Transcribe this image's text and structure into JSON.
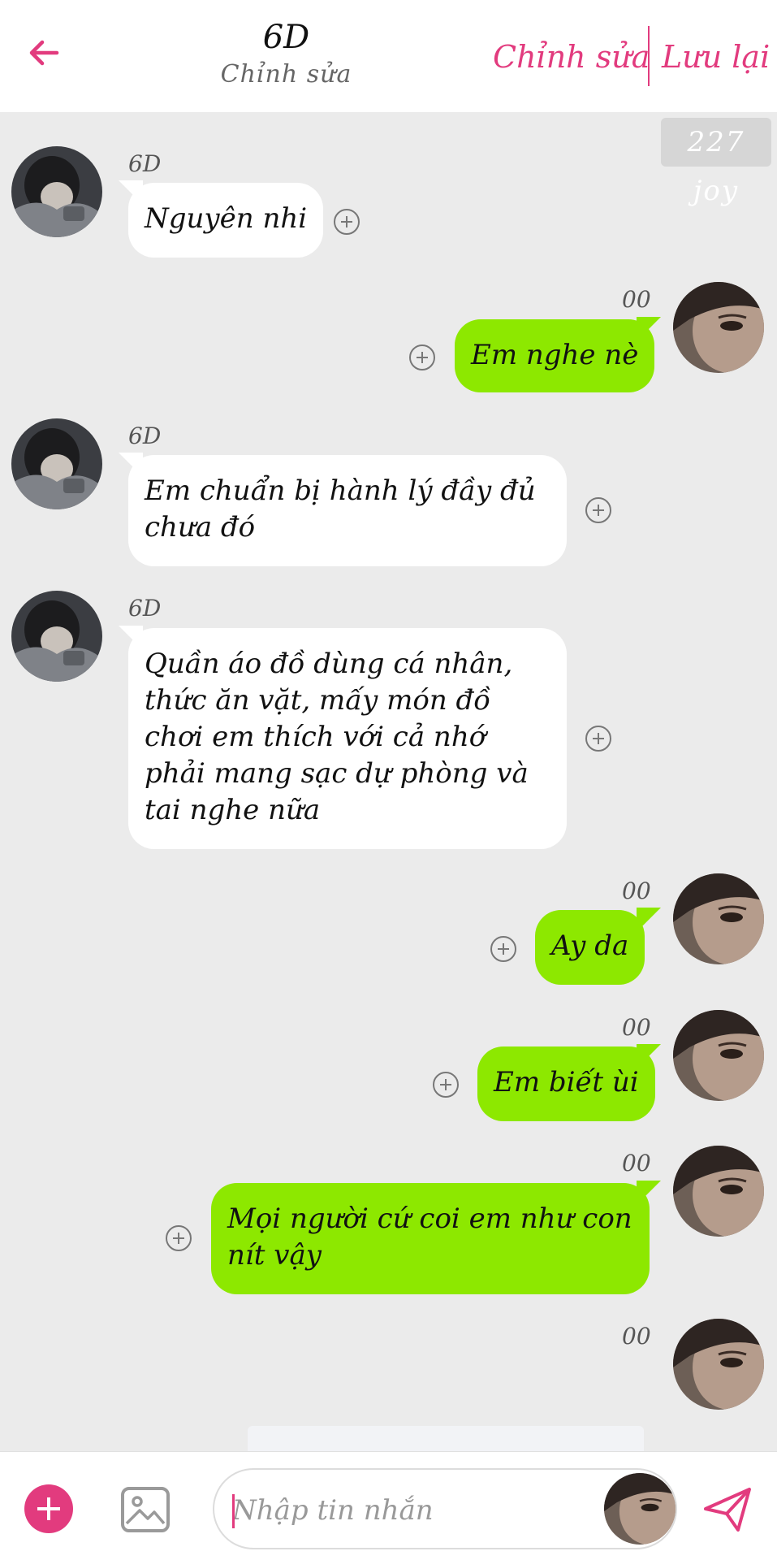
{
  "header": {
    "title": "6D",
    "subtitle": "Chỉnh sửa",
    "edit_label": "Chỉnh sửa",
    "save_label": "Lưu lại",
    "accent_color": "#e23b7e"
  },
  "watermark": "227 joy",
  "messages": [
    {
      "side": "left",
      "sender": "6D",
      "text": "Nguyên nhi"
    },
    {
      "side": "right",
      "sender": "00",
      "text": "Em nghe nè"
    },
    {
      "side": "left",
      "sender": "6D",
      "lines": [
        "Em chuẩn bị hành lý đầy đủ",
        "chưa đó"
      ]
    },
    {
      "side": "left",
      "sender": "6D",
      "lines": [
        "Quần áo đồ dùng cá nhân,",
        "thức ăn vặt, mấy món đồ",
        "chơi em thích với cả nhớ",
        "phải mang sạc dự phòng và",
        "tai nghe nữa"
      ]
    },
    {
      "side": "right",
      "sender": "00",
      "text": "Ay da"
    },
    {
      "side": "right",
      "sender": "00",
      "text": "Em biết ùi"
    },
    {
      "side": "right",
      "sender": "00",
      "lines": [
        "Mọi người cứ coi em như con",
        "nít vậy"
      ]
    },
    {
      "side": "right",
      "sender": "00",
      "text": ""
    }
  ],
  "input": {
    "placeholder": "Nhập tin nhắn",
    "value": ""
  },
  "colors": {
    "right_bubble": "#8de800",
    "left_bubble": "#ffffff",
    "background": "#ebebeb"
  },
  "icons": {
    "back": "arrow-left-icon",
    "add": "plus-circle-icon",
    "image": "image-icon",
    "send": "paper-plane-icon",
    "attach": "plus-circle-small-icon"
  }
}
